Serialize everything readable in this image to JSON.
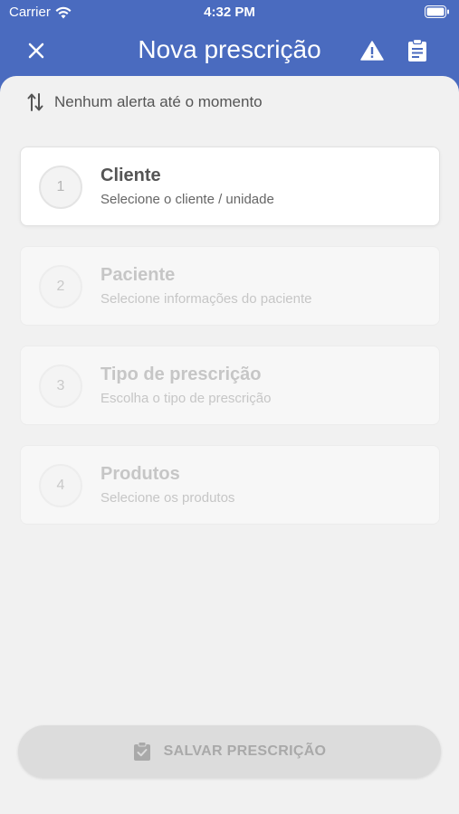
{
  "status_bar": {
    "carrier": "Carrier",
    "time": "4:32 PM"
  },
  "nav": {
    "title": "Nova prescrição"
  },
  "alerts": {
    "text": "Nenhum alerta até o momento"
  },
  "steps": [
    {
      "number": "1",
      "title": "Cliente",
      "subtitle": "Selecione o cliente / unidade",
      "active": true
    },
    {
      "number": "2",
      "title": "Paciente",
      "subtitle": "Selecione informações do paciente",
      "active": false
    },
    {
      "number": "3",
      "title": "Tipo de prescrição",
      "subtitle": "Escolha o tipo de prescrição",
      "active": false
    },
    {
      "number": "4",
      "title": "Produtos",
      "subtitle": "Selecione os produtos",
      "active": false
    }
  ],
  "save_button": {
    "label": "SALVAR PRESCRIÇÃO"
  },
  "colors": {
    "header": "#4a6bbf",
    "background": "#f1f1f1",
    "disabled_button": "#dcdcdc"
  },
  "icons": [
    "wifi-icon",
    "battery-icon",
    "close-icon",
    "warning-icon",
    "clipboard-icon",
    "sort-arrows-icon",
    "clipboard-check-icon"
  ]
}
